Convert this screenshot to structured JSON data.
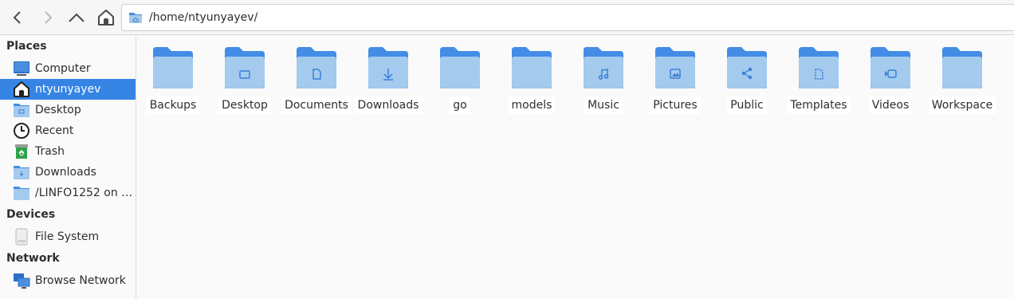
{
  "toolbar": {
    "path": "/home/ntyunyayev/"
  },
  "sidebar": {
    "places_title": "Places",
    "devices_title": "Devices",
    "network_title": "Network",
    "places": [
      {
        "label": "Computer",
        "icon": "computer-icon"
      },
      {
        "label": "ntyunyayev",
        "icon": "home-icon",
        "selected": true
      },
      {
        "label": "Desktop",
        "icon": "desktop-folder-icon"
      },
      {
        "label": "Recent",
        "icon": "clock-icon"
      },
      {
        "label": "Trash",
        "icon": "trash-icon"
      },
      {
        "label": "Downloads",
        "icon": "downloads-folder-icon"
      },
      {
        "label": "/LINFO1252 on i…",
        "icon": "network-folder-icon"
      }
    ],
    "devices": [
      {
        "label": "File System",
        "icon": "drive-icon"
      }
    ],
    "network": [
      {
        "label": "Browse Network",
        "icon": "network-icon"
      }
    ]
  },
  "folders": [
    {
      "label": "Backups",
      "emblem": "none"
    },
    {
      "label": "Desktop",
      "emblem": "desktop"
    },
    {
      "label": "Documents",
      "emblem": "document"
    },
    {
      "label": "Downloads",
      "emblem": "download"
    },
    {
      "label": "go",
      "emblem": "none"
    },
    {
      "label": "models",
      "emblem": "none"
    },
    {
      "label": "Music",
      "emblem": "music"
    },
    {
      "label": "Pictures",
      "emblem": "picture"
    },
    {
      "label": "Public",
      "emblem": "share"
    },
    {
      "label": "Templates",
      "emblem": "template"
    },
    {
      "label": "Videos",
      "emblem": "video"
    },
    {
      "label": "Workspace",
      "emblem": "none"
    }
  ],
  "colors": {
    "accent": "#3584e4",
    "folder_back": "#438de6",
    "folder_front": "#a4caee",
    "emblem": "#3a7fd6"
  }
}
